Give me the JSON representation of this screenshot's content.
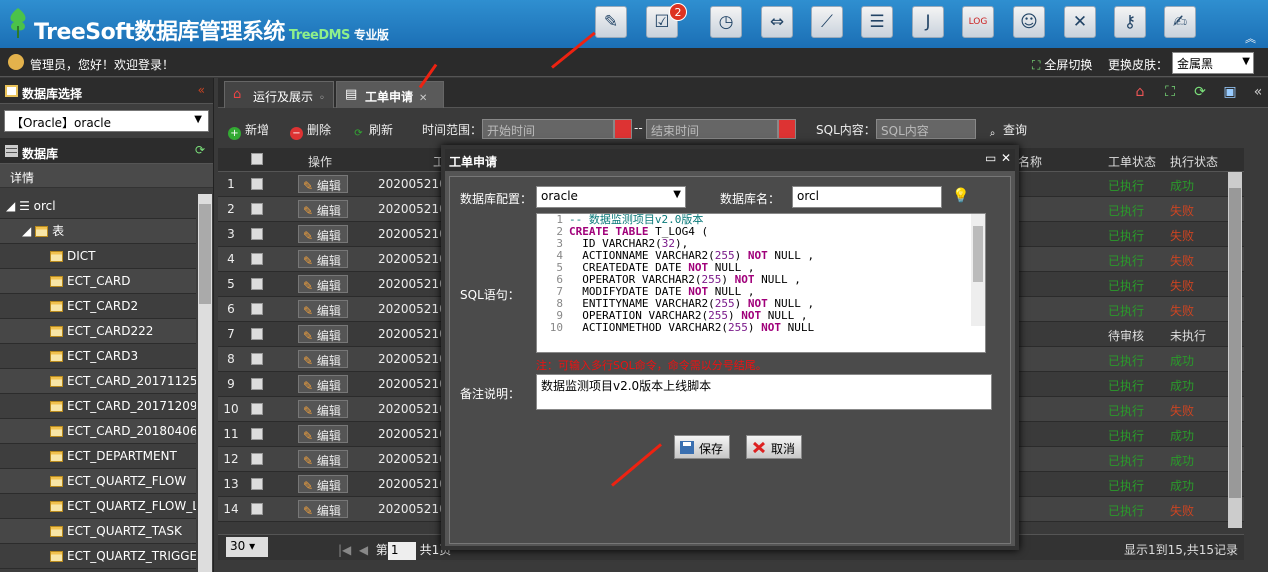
{
  "app": {
    "title": "TreeSoft数据库管理系统",
    "subtitle": "TreeDMS",
    "edition": "专业版"
  },
  "toolbar_icons": [
    "pen-ruler-icon",
    "checklist-icon",
    "clock-icon",
    "swap-arrows-icon",
    "chart-icon",
    "database-icon",
    "java-icon",
    "log-icon",
    "user-icon",
    "tools-icon",
    "key-icon",
    "signature-icon"
  ],
  "badge_count": "2",
  "header": {
    "welcome": "管理员，您好！欢迎登录！",
    "fullscreen": "全屏切换",
    "skin_label": "更换皮肤：",
    "skin_value": "金属黑"
  },
  "left": {
    "db_select_title": "数据库选择",
    "db_selected": "【Oracle】oracle",
    "db_title": "数据库",
    "detail": "详情",
    "tree": [
      {
        "label": "orcl"
      },
      {
        "label": "表"
      },
      {
        "label": "DICT"
      },
      {
        "label": "ECT_CARD"
      },
      {
        "label": "ECT_CARD2"
      },
      {
        "label": "ECT_CARD222"
      },
      {
        "label": "ECT_CARD3"
      },
      {
        "label": "ECT_CARD_2017112521"
      },
      {
        "label": "ECT_CARD_2017120911"
      },
      {
        "label": "ECT_CARD_2018040611"
      },
      {
        "label": "ECT_DEPARTMENT"
      },
      {
        "label": "ECT_QUARTZ_FLOW"
      },
      {
        "label": "ECT_QUARTZ_FLOW_LOG"
      },
      {
        "label": "ECT_QUARTZ_TASK"
      },
      {
        "label": "ECT_QUARTZ_TRIGGER"
      }
    ]
  },
  "tabs": [
    {
      "label": "运行及展示"
    },
    {
      "label": "工单申请"
    }
  ],
  "tools": {
    "add": "新增",
    "delete": "删除",
    "refresh": "刷新",
    "time_range": "时间范围：",
    "start_ph": "开始时间",
    "end_ph": "结束时间",
    "sql_label": "SQL内容：",
    "sql_ph": "SQL内容",
    "query": "查询"
  },
  "grid": {
    "headers": {
      "op": "操作",
      "name": "名称",
      "status": "工单状态",
      "exec": "执行状态"
    },
    "rows": [
      {
        "n": "1",
        "t": "202005210",
        "s1": "已执行",
        "s2": "成功",
        "c1": "g",
        "c2": "g"
      },
      {
        "n": "2",
        "t": "202005210",
        "s1": "已执行",
        "s2": "失败",
        "c1": "g",
        "c2": "r"
      },
      {
        "n": "3",
        "t": "202005210",
        "s1": "已执行",
        "s2": "失败",
        "c1": "g",
        "c2": "r"
      },
      {
        "n": "4",
        "t": "202005210",
        "s1": "已执行",
        "s2": "失败",
        "c1": "g",
        "c2": "r"
      },
      {
        "n": "5",
        "t": "202005210",
        "s1": "已执行",
        "s2": "失败",
        "c1": "g",
        "c2": "r"
      },
      {
        "n": "6",
        "t": "202005210",
        "s1": "已执行",
        "s2": "失败",
        "c1": "g",
        "c2": "r"
      },
      {
        "n": "7",
        "t": "202005210",
        "s1": "待审核",
        "s2": "未执行",
        "c1": "w",
        "c2": "w"
      },
      {
        "n": "8",
        "t": "202005210",
        "s1": "已执行",
        "s2": "成功",
        "c1": "g",
        "c2": "g"
      },
      {
        "n": "9",
        "t": "202005210",
        "s1": "已执行",
        "s2": "成功",
        "c1": "g",
        "c2": "g"
      },
      {
        "n": "10",
        "t": "202005210",
        "s1": "已执行",
        "s2": "失败",
        "c1": "g",
        "c2": "r"
      },
      {
        "n": "11",
        "t": "202005210",
        "s1": "已执行",
        "s2": "成功",
        "c1": "g",
        "c2": "g"
      },
      {
        "n": "12",
        "t": "202005210",
        "s1": "已执行",
        "s2": "成功",
        "c1": "g",
        "c2": "g"
      },
      {
        "n": "13",
        "t": "202005210",
        "s1": "已执行",
        "s2": "成功",
        "c1": "g",
        "c2": "g"
      },
      {
        "n": "14",
        "t": "202005210",
        "s1": "已执行",
        "s2": "失败",
        "c1": "g",
        "c2": "r"
      }
    ],
    "edit_label": "编辑"
  },
  "pager": {
    "page_size": "30",
    "page_label": "第",
    "page": "1",
    "total_pages": "共1页",
    "info": "显示1到15,共15记录"
  },
  "dialog": {
    "title": "工单申请",
    "db_config_label": "数据库配置：",
    "db_config_value": "oracle",
    "db_name_label": "数据库名：",
    "db_name_value": "orcl",
    "sql_label": "SQL语句：",
    "hint": "注：可输入多行SQL命令，命令需以分号结尾。",
    "remark_label": "备注说明：",
    "remark_value": "数据监测项目v2.0版本上线脚本",
    "save": "保存",
    "cancel": "取消"
  }
}
